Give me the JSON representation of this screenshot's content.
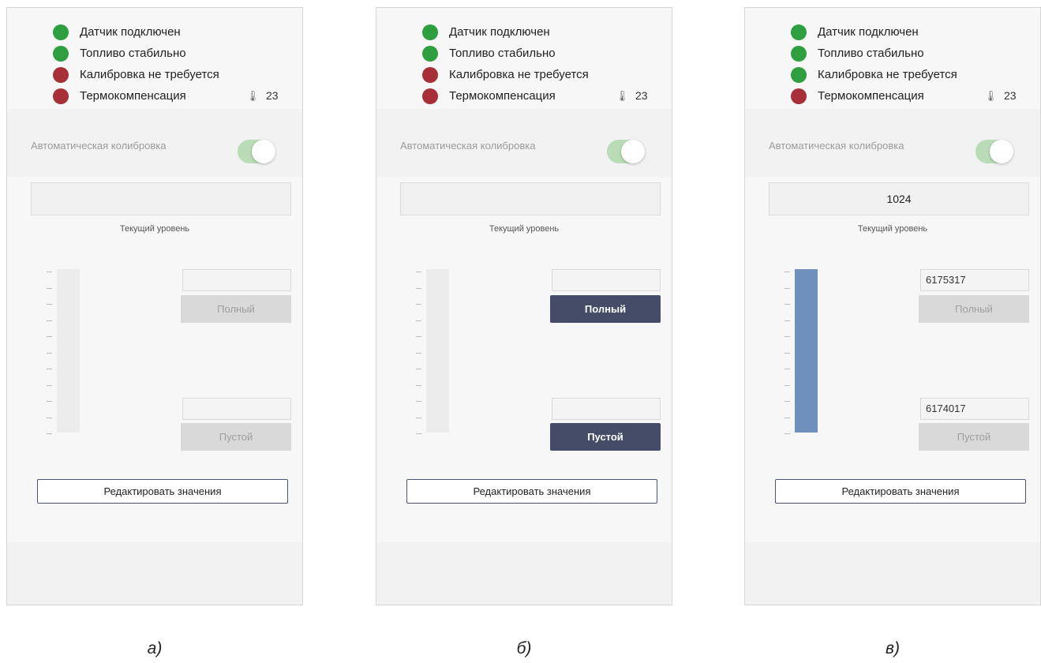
{
  "colors": {
    "green": "#2e9e3e",
    "red": "#a72f39",
    "bar_fill": "#6f8fbd",
    "active_button": "#444c68",
    "toggle_on": "#b9dbb5"
  },
  "panels": [
    {
      "status": [
        {
          "label": "Датчик подключен",
          "state": "green"
        },
        {
          "label": "Топливо стабильно",
          "state": "green"
        },
        {
          "label": "Калибровка не требуется",
          "state": "red"
        },
        {
          "label": "Термокомпенсация",
          "state": "red",
          "icon": "thermometer-icon",
          "value": "23"
        }
      ],
      "auto_calibration_label": "Автоматическая колибровка",
      "auto_calibration_on": true,
      "current_level_value": "",
      "current_level_label": "Текущий уровень",
      "level_fraction": 0,
      "full_value": "",
      "full_label": "Полный",
      "full_enabled": false,
      "empty_value": "",
      "empty_label": "Пустой",
      "empty_enabled": false,
      "edit_label": "Редактировать значения",
      "caption": "а)"
    },
    {
      "status": [
        {
          "label": "Датчик подключен",
          "state": "green"
        },
        {
          "label": "Топливо стабильно",
          "state": "green"
        },
        {
          "label": "Калибровка не требуется",
          "state": "red"
        },
        {
          "label": "Термокомпенсация",
          "state": "red",
          "icon": "thermometer-icon",
          "value": "23"
        }
      ],
      "auto_calibration_label": "Автоматическая колибровка",
      "auto_calibration_on": true,
      "current_level_value": "",
      "current_level_label": "Текущий уровень",
      "level_fraction": 0,
      "full_value": "",
      "full_label": "Полный",
      "full_enabled": true,
      "empty_value": "",
      "empty_label": "Пустой",
      "empty_enabled": true,
      "edit_label": "Редактировать значения",
      "caption": "б)"
    },
    {
      "status": [
        {
          "label": "Датчик подключен",
          "state": "green"
        },
        {
          "label": "Топливо стабильно",
          "state": "green"
        },
        {
          "label": "Калибровка не требуется",
          "state": "green"
        },
        {
          "label": "Термокомпенсация",
          "state": "red",
          "icon": "thermometer-icon",
          "value": "23"
        }
      ],
      "auto_calibration_label": "Автоматическая колибровка",
      "auto_calibration_on": true,
      "current_level_value": "1024",
      "current_level_label": "Текущий уровень",
      "level_fraction": 1,
      "full_value": "6175317",
      "full_label": "Полный",
      "full_enabled": false,
      "empty_value": "6174017",
      "empty_label": "Пустой",
      "empty_enabled": false,
      "edit_label": "Редактировать значения",
      "caption": "в)"
    }
  ]
}
